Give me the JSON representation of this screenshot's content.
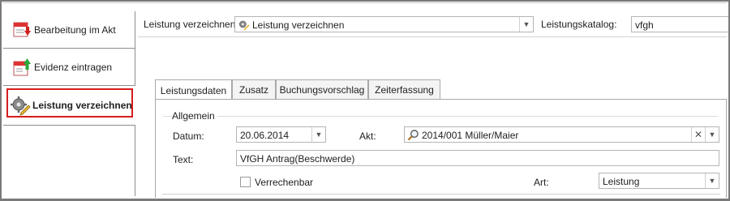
{
  "sidebar": {
    "items": [
      {
        "label": "Bearbeitung im Akt",
        "icon": "calendar-arrow-down-icon"
      },
      {
        "label": "Evidenz eintragen",
        "icon": "calendar-arrow-up-icon"
      },
      {
        "label": "Leistung verzeichnen",
        "icon": "gear-pencil-icon",
        "active": true
      }
    ]
  },
  "topbar": {
    "leistung_label": "Leistung verzeichnen:",
    "leistung_value": "Leistung verzeichnen",
    "katalog_label": "Leistungskatalog:",
    "katalog_value": "vfgh"
  },
  "tabs": [
    {
      "label": "Leistungsdaten",
      "active": true
    },
    {
      "label": "Zusatz"
    },
    {
      "label": "Buchungsvorschlag"
    },
    {
      "label": "Zeiterfassung"
    }
  ],
  "form": {
    "group_title": "Allgemein",
    "datum_label": "Datum:",
    "datum_value": "20.06.2014",
    "akt_label": "Akt:",
    "akt_value": "2014/001 Müller/Maier",
    "text_label": "Text:",
    "text_value": "VfGH Antrag(Beschwerde)",
    "verrechenbar_label": "Verrechenbar",
    "verrechenbar_checked": false,
    "art_label": "Art:",
    "art_value": "Leistung"
  },
  "colors": {
    "active_outline": "#d61d1d",
    "border": "#8d8d8d"
  }
}
